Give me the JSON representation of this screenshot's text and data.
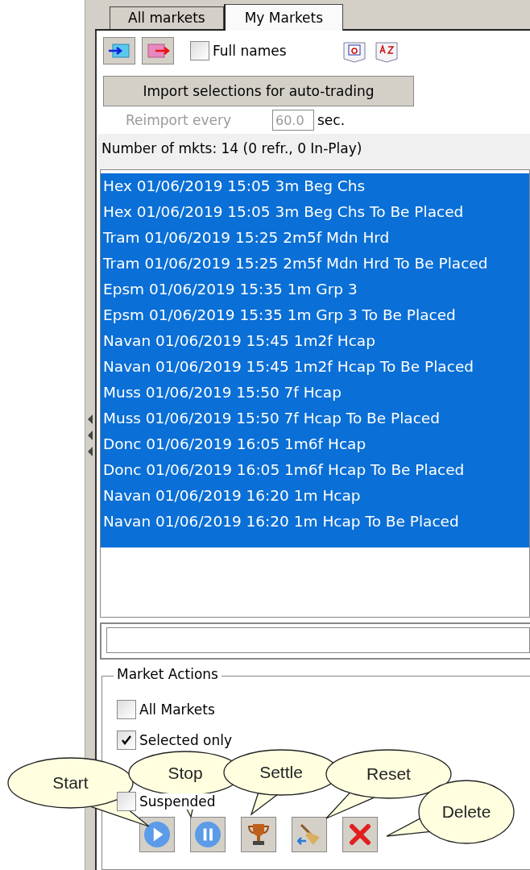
{
  "tabs": [
    {
      "label": "All markets",
      "selected": false
    },
    {
      "label": "My Markets",
      "selected": true
    }
  ],
  "full_names": {
    "label": "Full names",
    "checked": false
  },
  "import_button": "Import selections for auto-trading",
  "reimport": {
    "label": "Reimport every",
    "value": "60.0",
    "unit": "sec.",
    "disabled": true
  },
  "summary": "Number of mkts: 14 (0 refr., 0 In-Play)",
  "markets": [
    {
      "name": "Hex 01/06/2019 15:05 3m Beg Chs",
      "selected": true
    },
    {
      "name": "Hex 01/06/2019 15:05 3m Beg Chs To Be Placed",
      "selected": true
    },
    {
      "name": "Tram 01/06/2019 15:25 2m5f Mdn Hrd",
      "selected": true
    },
    {
      "name": "Tram 01/06/2019 15:25 2m5f Mdn Hrd To Be Placed",
      "selected": true
    },
    {
      "name": "Epsm 01/06/2019 15:35 1m Grp 3",
      "selected": true
    },
    {
      "name": "Epsm 01/06/2019 15:35 1m Grp 3 To Be Placed",
      "selected": true
    },
    {
      "name": "Navan 01/06/2019 15:45 1m2f Hcap",
      "selected": true
    },
    {
      "name": "Navan 01/06/2019 15:45 1m2f Hcap To Be Placed",
      "selected": true
    },
    {
      "name": "Muss 01/06/2019 15:50 7f Hcap",
      "selected": true
    },
    {
      "name": "Muss 01/06/2019 15:50 7f Hcap To Be Placed",
      "selected": true
    },
    {
      "name": "Donc 01/06/2019 16:05 1m6f Hcap",
      "selected": true
    },
    {
      "name": "Donc 01/06/2019 16:05 1m6f Hcap To Be Placed",
      "selected": true
    },
    {
      "name": "Navan 01/06/2019 16:20 1m Hcap",
      "selected": true
    },
    {
      "name": "Navan 01/06/2019 16:20 1m Hcap To Be Placed",
      "selected": true
    }
  ],
  "market_actions": {
    "title": "Market Actions",
    "options": [
      {
        "label": "All Markets",
        "checked": false
      },
      {
        "label": "Selected only",
        "checked": true
      },
      {
        "label": "Suspended",
        "checked": false
      }
    ]
  },
  "callouts": [
    "Start",
    "Stop",
    "Settle",
    "Reset",
    "Delete"
  ]
}
